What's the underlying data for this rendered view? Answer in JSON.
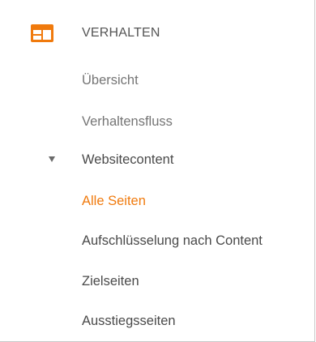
{
  "section": {
    "title": "VERHALTEN",
    "icon": "behavior-window-icon",
    "accent_color": "#f07a0d"
  },
  "nav": {
    "items": [
      {
        "label": "Übersicht"
      },
      {
        "label": "Verhaltensfluss"
      },
      {
        "label": "Websitecontent",
        "expanded": true
      },
      {
        "label": "Alle Seiten",
        "active": true
      },
      {
        "label": "Aufschlüsselung nach Content"
      },
      {
        "label": "Zielseiten"
      },
      {
        "label": "Ausstiegsseiten"
      }
    ]
  }
}
